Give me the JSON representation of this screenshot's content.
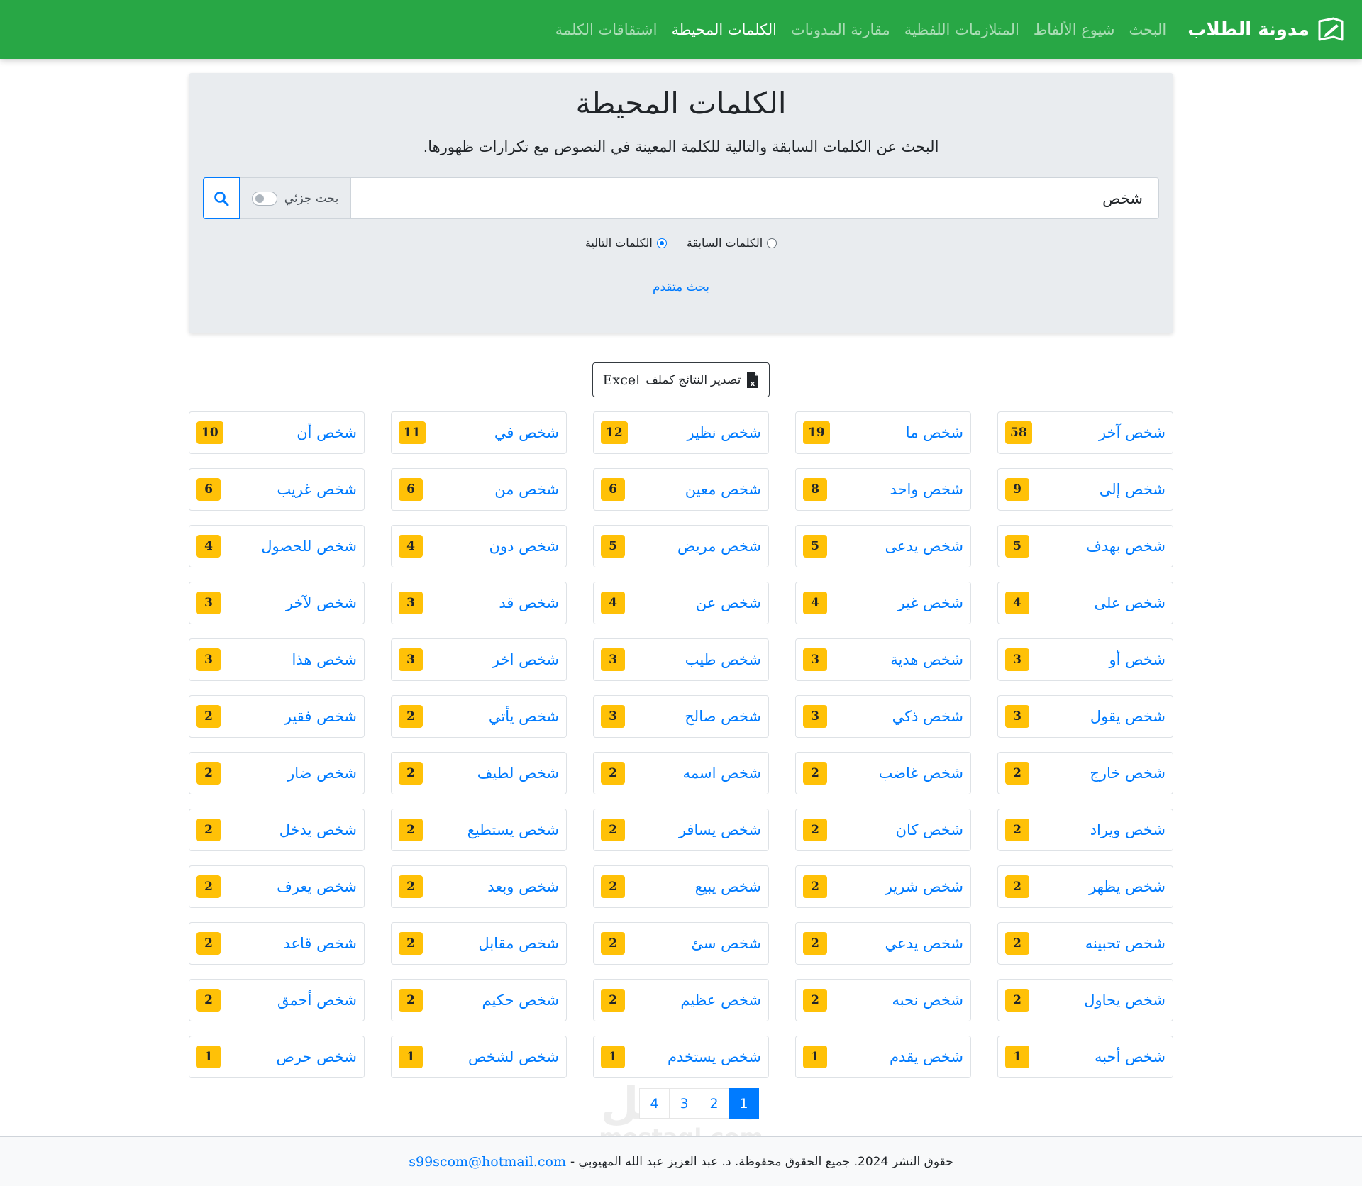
{
  "navbar": {
    "brand": "مدونة الطلاب",
    "links": [
      {
        "label": "البحث",
        "active": false
      },
      {
        "label": "شيوع الألفاظ",
        "active": false
      },
      {
        "label": "المتلازمات اللفظية",
        "active": false
      },
      {
        "label": "مقارنة المدونات",
        "active": false
      },
      {
        "label": "الكلمات المحيطة",
        "active": true
      },
      {
        "label": "اشتقاقات الكلمة",
        "active": false
      }
    ]
  },
  "header": {
    "title": "الكلمات المحيطة",
    "subtitle": "البحث عن الكلمات السابقة والتالية للكلمة المعينة في النصوص مع تكرارات ظهورها."
  },
  "search": {
    "value": "شخص",
    "partial_label": "بحث جزئي",
    "partial_enabled": false
  },
  "options": {
    "previous_label": "الكلمات السابقة",
    "next_label": "الكلمات التالية",
    "selected": "next"
  },
  "advanced_label": "بحث متقدم",
  "export": {
    "label": "تصدير النتائج كملف",
    "format": "Excel"
  },
  "results": [
    {
      "word": "شخص آخر",
      "count": "58"
    },
    {
      "word": "شخص ما",
      "count": "19"
    },
    {
      "word": "شخص نظير",
      "count": "12"
    },
    {
      "word": "شخص في",
      "count": "11"
    },
    {
      "word": "شخص أن",
      "count": "10"
    },
    {
      "word": "شخص إلى",
      "count": "9"
    },
    {
      "word": "شخص واحد",
      "count": "8"
    },
    {
      "word": "شخص معين",
      "count": "6"
    },
    {
      "word": "شخص من",
      "count": "6"
    },
    {
      "word": "شخص غريب",
      "count": "6"
    },
    {
      "word": "شخص بهدف",
      "count": "5"
    },
    {
      "word": "شخص يدعى",
      "count": "5"
    },
    {
      "word": "شخص مريض",
      "count": "5"
    },
    {
      "word": "شخص دون",
      "count": "4"
    },
    {
      "word": "شخص للحصول",
      "count": "4"
    },
    {
      "word": "شخص على",
      "count": "4"
    },
    {
      "word": "شخص غير",
      "count": "4"
    },
    {
      "word": "شخص عن",
      "count": "4"
    },
    {
      "word": "شخص قد",
      "count": "3"
    },
    {
      "word": "شخص لآخر",
      "count": "3"
    },
    {
      "word": "شخص أو",
      "count": "3"
    },
    {
      "word": "شخص هدية",
      "count": "3"
    },
    {
      "word": "شخص طيب",
      "count": "3"
    },
    {
      "word": "شخص اخر",
      "count": "3"
    },
    {
      "word": "شخص هذا",
      "count": "3"
    },
    {
      "word": "شخص يقول",
      "count": "3"
    },
    {
      "word": "شخص ذكي",
      "count": "3"
    },
    {
      "word": "شخص صالح",
      "count": "3"
    },
    {
      "word": "شخص يأتي",
      "count": "2"
    },
    {
      "word": "شخص فقير",
      "count": "2"
    },
    {
      "word": "شخص خارج",
      "count": "2"
    },
    {
      "word": "شخص غاضب",
      "count": "2"
    },
    {
      "word": "شخص اسمه",
      "count": "2"
    },
    {
      "word": "شخص لطيف",
      "count": "2"
    },
    {
      "word": "شخص ضار",
      "count": "2"
    },
    {
      "word": "شخص ويراد",
      "count": "2"
    },
    {
      "word": "شخص كان",
      "count": "2"
    },
    {
      "word": "شخص يسافر",
      "count": "2"
    },
    {
      "word": "شخص يستطيع",
      "count": "2"
    },
    {
      "word": "شخص يدخل",
      "count": "2"
    },
    {
      "word": "شخص يظهر",
      "count": "2"
    },
    {
      "word": "شخص شرير",
      "count": "2"
    },
    {
      "word": "شخص يبيع",
      "count": "2"
    },
    {
      "word": "شخص وبعد",
      "count": "2"
    },
    {
      "word": "شخص يعرف",
      "count": "2"
    },
    {
      "word": "شخص تحبينه",
      "count": "2"
    },
    {
      "word": "شخص يدعي",
      "count": "2"
    },
    {
      "word": "شخص سئ",
      "count": "2"
    },
    {
      "word": "شخص مقابل",
      "count": "2"
    },
    {
      "word": "شخص قاعد",
      "count": "2"
    },
    {
      "word": "شخص يحاول",
      "count": "2"
    },
    {
      "word": "شخص نحبه",
      "count": "2"
    },
    {
      "word": "شخص عظيم",
      "count": "2"
    },
    {
      "word": "شخص حكيم",
      "count": "2"
    },
    {
      "word": "شخص أحمق",
      "count": "2"
    },
    {
      "word": "شخص أحبه",
      "count": "1"
    },
    {
      "word": "شخص يقدم",
      "count": "1"
    },
    {
      "word": "شخص يستخدم",
      "count": "1"
    },
    {
      "word": "شخص لشخص",
      "count": "1"
    },
    {
      "word": "شخص حرص",
      "count": "1"
    }
  ],
  "pagination": {
    "pages": [
      "1",
      "2",
      "3",
      "4"
    ],
    "current": "1"
  },
  "watermark": {
    "ar": "مستقل",
    "en": "mostaql.com"
  },
  "footer": {
    "text": "حقوق النشر 2024. جميع الحقوق محفوظة. د. عبد العزيز عبد الله المهيوبي -",
    "email": "s99scom@hotmail.com"
  },
  "colors": {
    "navbar": "#28a745",
    "link": "#007bff",
    "badge": "#ffc107",
    "jumbotron": "#e9ecef"
  },
  "icons": {
    "brand": "book-edit-icon",
    "search": "search-icon",
    "export": "excel-file-icon"
  }
}
